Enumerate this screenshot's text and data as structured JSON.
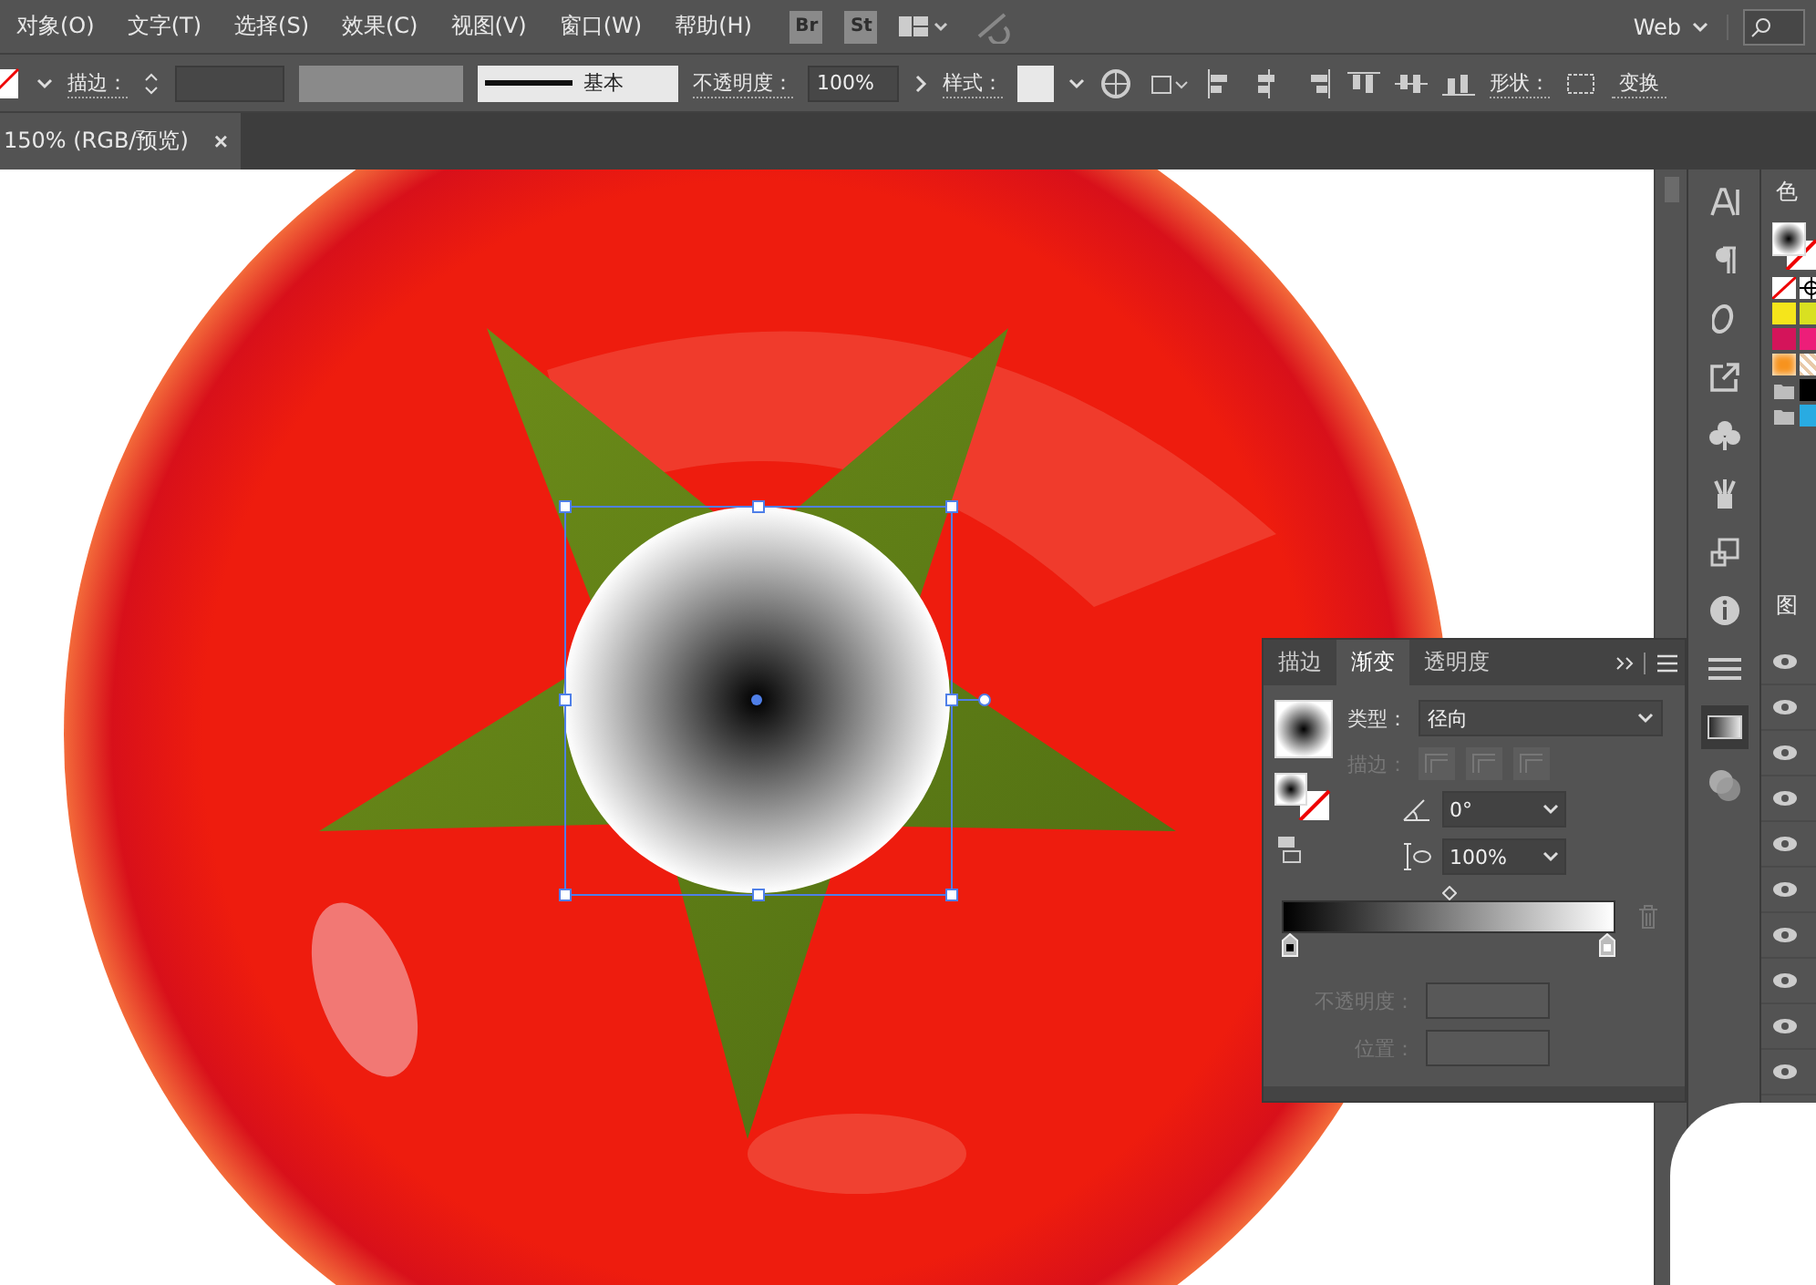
{
  "menu_bar": {
    "items": [
      "对象(O)",
      "文字(T)",
      "选择(S)",
      "效果(C)",
      "视图(V)",
      "窗口(W)",
      "帮助(H)"
    ],
    "app_buttons": [
      "Br",
      "St"
    ],
    "workspace": "Web"
  },
  "control_bar": {
    "stroke_label": "描边：",
    "stroke_style": "基本",
    "opacity_label": "不透明度：",
    "opacity_value": "100%",
    "style_label": "样式：",
    "shape_label": "形状：",
    "transform_button": "变换"
  },
  "document_tab": {
    "title": "150% (RGB/预览)",
    "close": "×"
  },
  "gradient_panel": {
    "tabs": [
      {
        "label": "描边",
        "selected": false
      },
      {
        "label": "渐变",
        "selected": true
      },
      {
        "label": "透明度",
        "selected": false
      }
    ],
    "type_label": "类型：",
    "type_value": "径向",
    "stroke_label": "描边：",
    "stroke_disabled": true,
    "angle_value": "0°",
    "aspect_value": "100%",
    "opacity_label": "不透明度：",
    "opacity_disabled": true,
    "location_label": "位置：",
    "location_disabled": true,
    "stops": [
      {
        "color": "#000000"
      },
      {
        "color": "#ffffff"
      }
    ]
  },
  "swatches_panel": {
    "title": "色",
    "swatches": [
      {
        "kind": "none",
        "color": "#ffffff"
      },
      {
        "kind": "registration",
        "color": "#000000"
      },
      {
        "kind": "solid",
        "color": "#f5e51b"
      },
      {
        "kind": "solid",
        "color": "#d9e021"
      },
      {
        "kind": "solid",
        "color": "#d4145a"
      },
      {
        "kind": "solid",
        "color": "#ed1e79"
      },
      {
        "kind": "gradient",
        "color": "#f7931e"
      },
      {
        "kind": "pattern",
        "color": "#e8c9a8"
      },
      {
        "kind": "folder",
        "color": "#bdbdbd"
      },
      {
        "kind": "solid",
        "color": "#000000"
      },
      {
        "kind": "folder",
        "color": "#bdbdbd"
      },
      {
        "kind": "solid",
        "color": "#29abe2"
      }
    ]
  },
  "layers_panel": {
    "title": "图",
    "layers": [
      {
        "visible": true
      },
      {
        "visible": true
      },
      {
        "visible": true
      },
      {
        "visible": true
      },
      {
        "visible": true
      },
      {
        "visible": true
      },
      {
        "visible": true
      },
      {
        "visible": true
      },
      {
        "visible": true
      },
      {
        "visible": true
      }
    ]
  }
}
